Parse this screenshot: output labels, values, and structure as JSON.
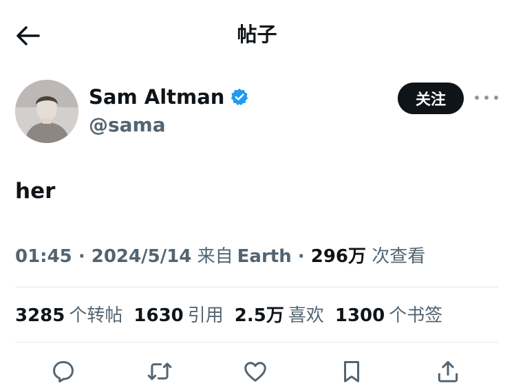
{
  "header": {
    "title": "帖子",
    "back_icon": "arrow-left-icon"
  },
  "author": {
    "display_name": "Sam Altman",
    "handle": "@sama",
    "verified_icon": "verified-badge-icon",
    "verified_color": "#1d9bf0",
    "follow_label": "关注",
    "more_icon": "more-horizontal-icon"
  },
  "tweet": {
    "text": "her",
    "time": "01:45",
    "date": "2024/5/14",
    "source_prefix": "来自",
    "source": "Earth",
    "views": "296万",
    "views_label": "次查看"
  },
  "stats": {
    "retweets": "3285",
    "retweets_label": "个转帖",
    "quotes": "1630",
    "quotes_label": "引用",
    "likes": "2.5万",
    "likes_label": "喜欢",
    "bookmarks": "1300",
    "bookmarks_label": "个书签"
  },
  "actions": {
    "reply_icon": "reply-icon",
    "retweet_icon": "retweet-icon",
    "like_icon": "heart-icon",
    "bookmark_icon": "bookmark-icon",
    "share_icon": "share-icon"
  },
  "colors": {
    "text_primary": "#0f1419",
    "text_secondary": "#536471",
    "divider": "#e3e7ea"
  }
}
